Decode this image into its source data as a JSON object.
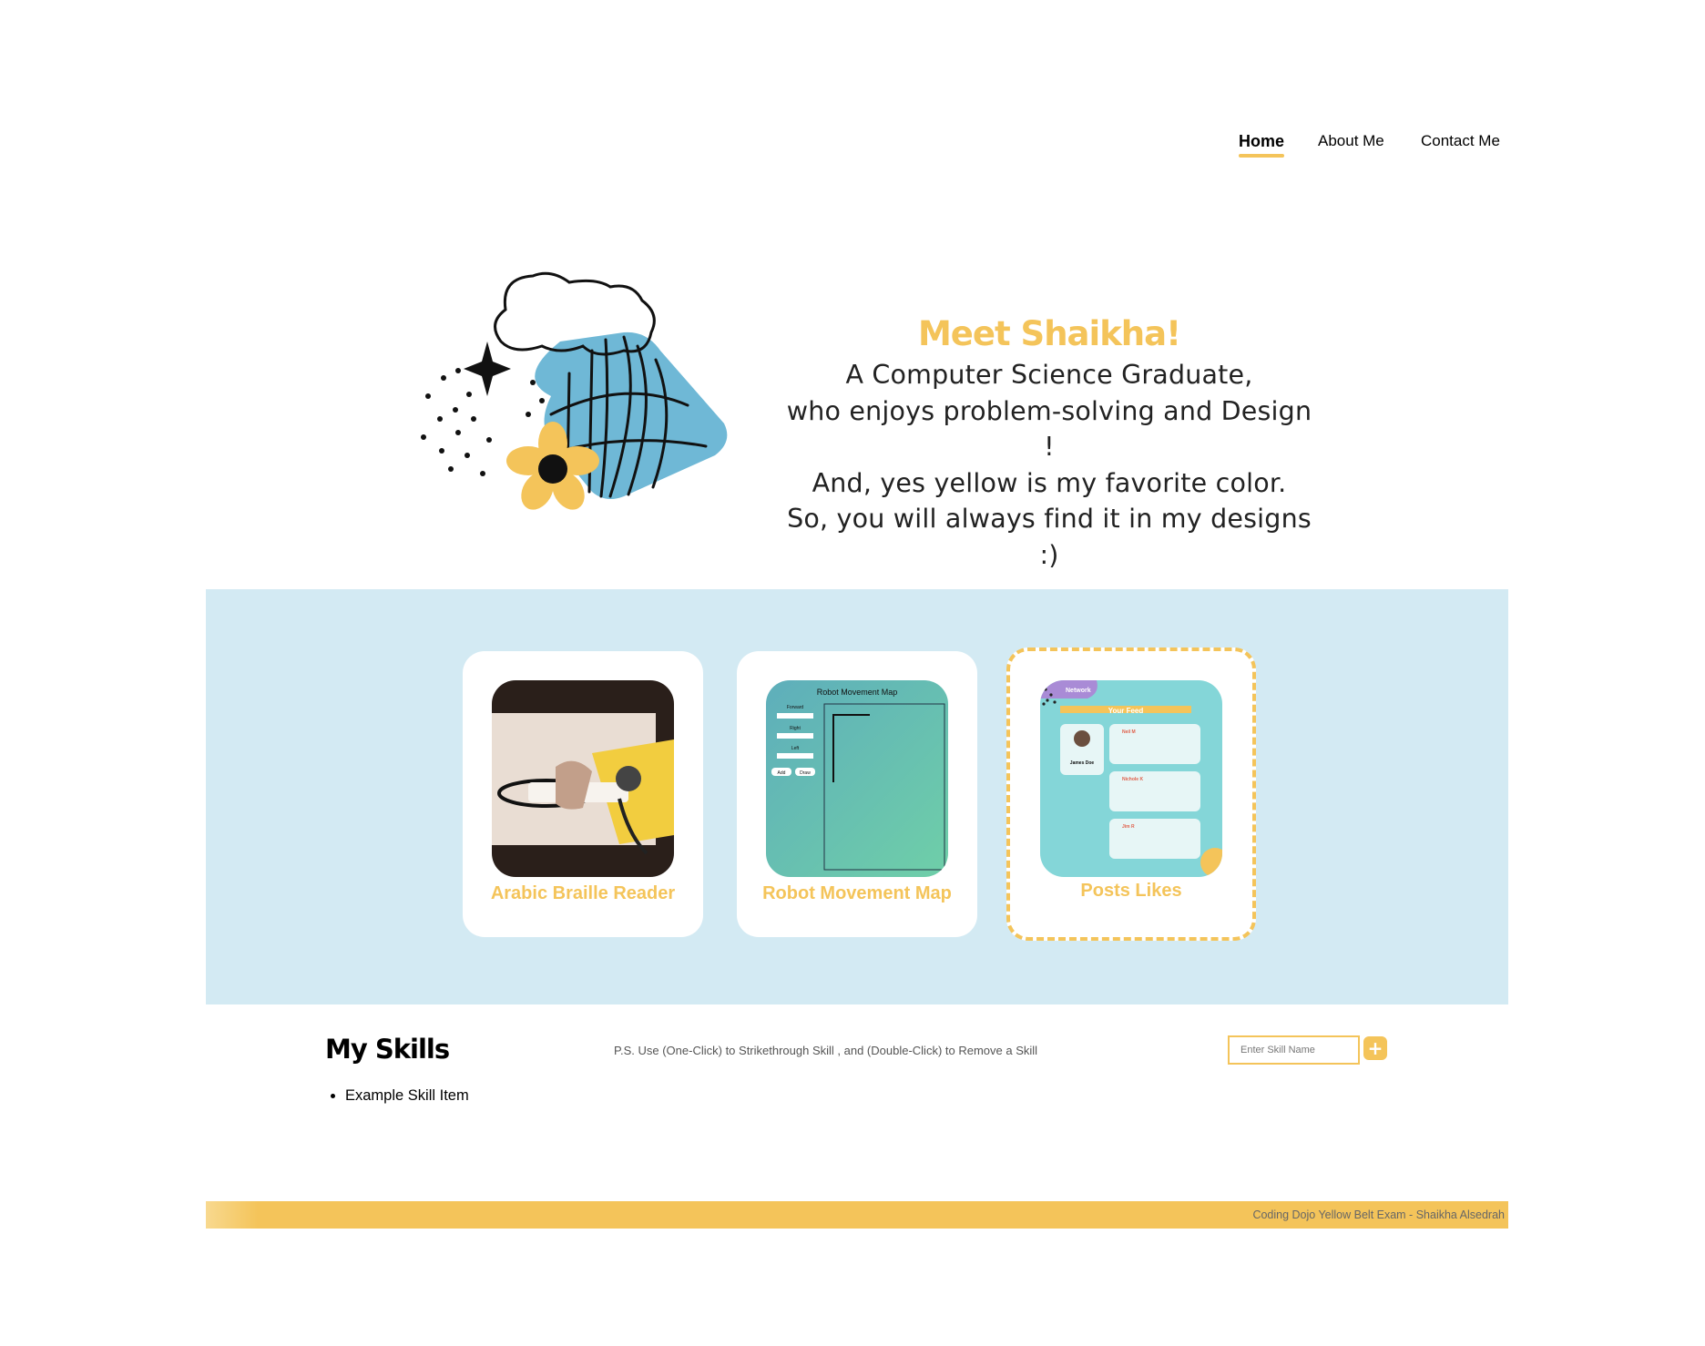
{
  "nav": {
    "home": "Home",
    "about": "About Me",
    "contact": "Contact Me"
  },
  "hero": {
    "title": "Meet Shaikha!",
    "lines": [
      "A Computer Science Graduate,",
      "who enjoys problem-solving and Design !",
      "And, yes yellow is my favorite color.",
      "So, you will always find it in my designs :)"
    ]
  },
  "projects": [
    {
      "title": "Arabic Braille Reader",
      "thumb_icon": "braille-reader-photo"
    },
    {
      "title": "Robot Movement Map",
      "thumb_icon": "robot-map-screenshot",
      "thumb_text": {
        "heading": "Robot Movement Map",
        "forward": "Forward",
        "right": "Right",
        "left": "Left",
        "add": "Add",
        "draw": "Draw"
      }
    },
    {
      "title": "Posts Likes",
      "thumb_icon": "posts-feed-screenshot",
      "thumb_text": {
        "badge": "Network",
        "feed": "Your Feed",
        "profile": "James Doe",
        "user1": "Neil M",
        "user2": "Nichole K",
        "user3": "Jim R"
      }
    }
  ],
  "skills": {
    "title": "My Skills",
    "hint": "P.S. Use (One-Click) to Strikethrough Skill , and (Double-Click) to Remove a Skill",
    "input_placeholder": "Enter Skill Name",
    "add_label": "+",
    "items": [
      "Example Skill Item"
    ]
  },
  "footer": {
    "text": "Coding Dojo Yellow Belt Exam - Shaikha Alsedrah"
  },
  "colors": {
    "accent": "#f4c45a",
    "band": "#d3eaf3",
    "blob": "#6fb8d6"
  }
}
